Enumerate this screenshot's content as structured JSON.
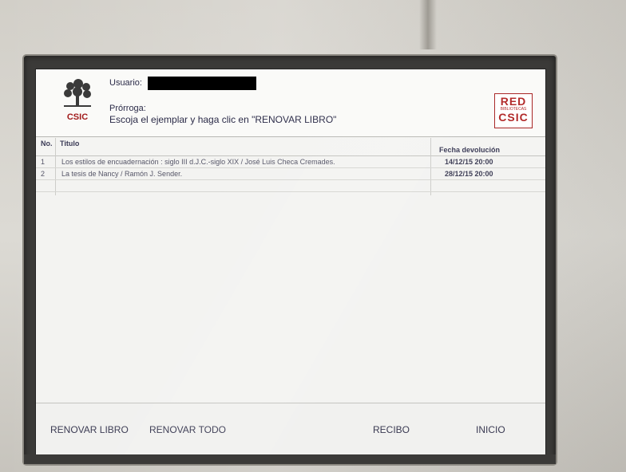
{
  "header": {
    "logo_left_text": "CSIC",
    "user_label": "Usuario:",
    "prorroga_label": "Prórroga:",
    "instruction": "Escoja el ejemplar y haga clic en \"RENOVAR LIBRO\"",
    "logo_right_top": "RED",
    "logo_right_mid": "BIBLIOTECAS",
    "logo_right_bottom": "CSIC"
  },
  "table": {
    "headers": {
      "no": "No.",
      "title": "Titulo",
      "fecha": "Fecha devolución"
    },
    "rows": [
      {
        "no": "1",
        "title": "Los estilos de encuadernación : siglo III d.J.C.-siglo XIX / José Luis Checa Cremades.",
        "fecha": "14/12/15 20:00"
      },
      {
        "no": "2",
        "title": "La tesis de Nancy / Ramón J. Sender.",
        "fecha": "28/12/15 20:00"
      }
    ]
  },
  "footer": {
    "renovar_libro": "RENOVAR LIBRO",
    "renovar_todo": "RENOVAR TODO",
    "recibo": "RECIBO",
    "inicio": "INICIO"
  },
  "colors": {
    "csic_red": "#a11b1b",
    "text_navy": "#2b2b48",
    "screen_bg": "#f3f3f1"
  }
}
